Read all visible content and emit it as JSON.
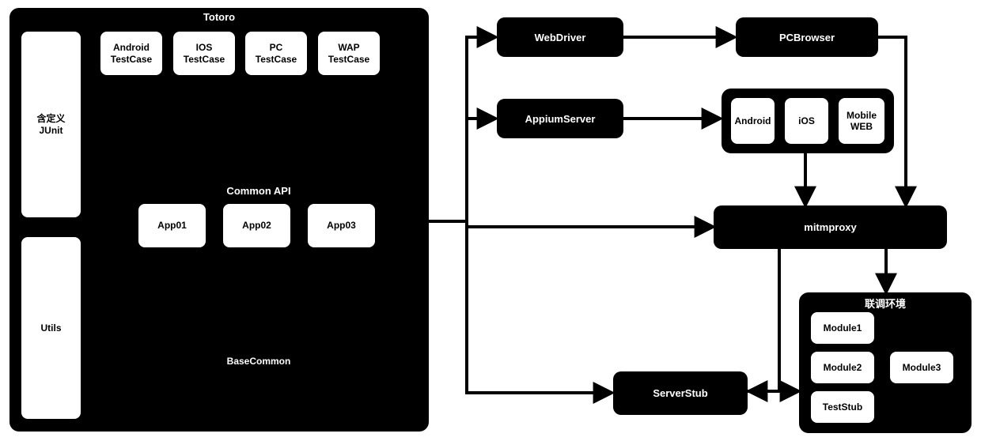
{
  "totoro": {
    "title": "Totoro",
    "junit": "含定义\nJUnit",
    "utils": "Utils",
    "testcases": {
      "android": "Android\nTestCase",
      "ios": "IOS\nTestCase",
      "pc": "PC\nTestCase",
      "wap": "WAP\nTestCase"
    },
    "commonapi": {
      "title": "Common API",
      "app1": "App01",
      "app2": "App02",
      "app3": "App03"
    },
    "basecommon": "BaseCommon"
  },
  "webdriver": "WebDriver",
  "pcbrowser": "PCBrowser",
  "appiumserver": "AppiumServer",
  "platforms": {
    "android": "Android",
    "ios": "iOS",
    "mobileweb": "Mobile\nWEB"
  },
  "mitmproxy": "mitmproxy",
  "serverstub": "ServerStub",
  "env": {
    "title": "联调环境",
    "module1": "Module1",
    "module2": "Module2",
    "module3": "Module3",
    "teststub": "TestStub"
  }
}
